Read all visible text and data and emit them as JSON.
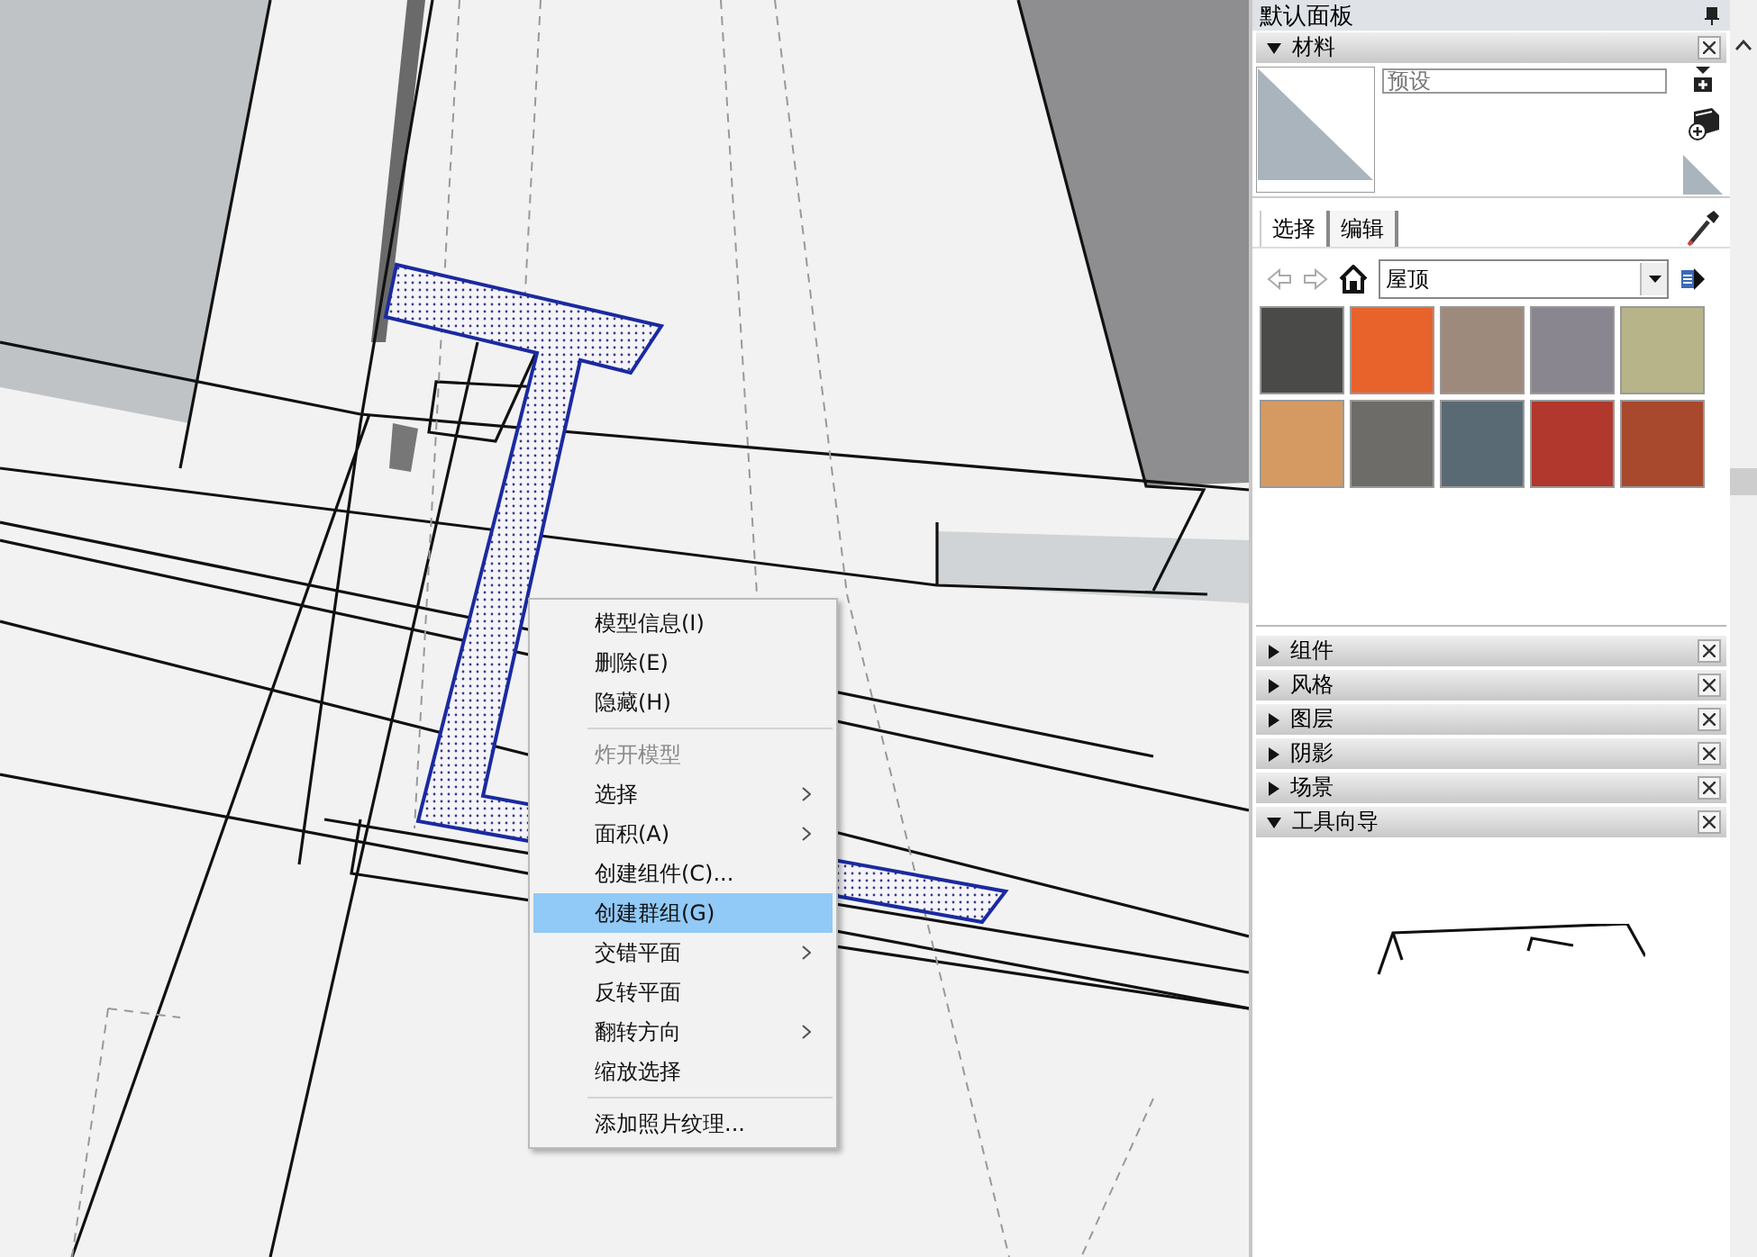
{
  "tray": {
    "title": "默认面板"
  },
  "materials": {
    "title": "材料",
    "expanded": true,
    "name_field": {
      "placeholder": "预设"
    },
    "tabs": [
      {
        "label": "选择",
        "selected": true
      },
      {
        "label": "编辑",
        "selected": false
      }
    ],
    "collection": {
      "value": "屋顶"
    },
    "swatches": [
      {
        "color": "#4a4a48"
      },
      {
        "color": "#e8622c"
      },
      {
        "color": "#9e8a7c"
      },
      {
        "color": "#8a8690"
      },
      {
        "color": "#b8b48a"
      },
      {
        "color": "#d49a62"
      },
      {
        "color": "#6e6c68"
      },
      {
        "color": "#5a6a74"
      },
      {
        "color": "#b0382c"
      },
      {
        "color": "#a8482c"
      }
    ]
  },
  "sections": [
    {
      "title": "组件",
      "expanded": false
    },
    {
      "title": "风格",
      "expanded": false
    },
    {
      "title": "图层",
      "expanded": false
    },
    {
      "title": "阴影",
      "expanded": false
    },
    {
      "title": "场景",
      "expanded": false
    },
    {
      "title": "工具向导",
      "expanded": true
    }
  ],
  "context_menu": {
    "items": [
      {
        "kind": "item",
        "label": "模型信息(I)",
        "disabled": false,
        "selected": false,
        "submenu": false
      },
      {
        "kind": "item",
        "label": "删除(E)",
        "disabled": false,
        "selected": false,
        "submenu": false
      },
      {
        "kind": "item",
        "label": "隐藏(H)",
        "disabled": false,
        "selected": false,
        "submenu": false
      },
      {
        "kind": "separator"
      },
      {
        "kind": "item",
        "label": "炸开模型",
        "disabled": true,
        "selected": false,
        "submenu": false
      },
      {
        "kind": "item",
        "label": "选择",
        "disabled": false,
        "selected": false,
        "submenu": true
      },
      {
        "kind": "item",
        "label": "面积(A)",
        "disabled": false,
        "selected": false,
        "submenu": true
      },
      {
        "kind": "item",
        "label": "创建组件(C)...",
        "disabled": false,
        "selected": false,
        "submenu": false
      },
      {
        "kind": "item",
        "label": "创建群组(G)",
        "disabled": false,
        "selected": true,
        "submenu": false
      },
      {
        "kind": "item",
        "label": "交错平面",
        "disabled": false,
        "selected": false,
        "submenu": true
      },
      {
        "kind": "item",
        "label": "反转平面",
        "disabled": false,
        "selected": false,
        "submenu": false
      },
      {
        "kind": "item",
        "label": "翻转方向",
        "disabled": false,
        "selected": false,
        "submenu": true
      },
      {
        "kind": "item",
        "label": "缩放选择",
        "disabled": false,
        "selected": false,
        "submenu": false
      },
      {
        "kind": "separator"
      },
      {
        "kind": "item",
        "label": "添加照片纹理...",
        "disabled": false,
        "selected": false,
        "submenu": false
      }
    ]
  }
}
